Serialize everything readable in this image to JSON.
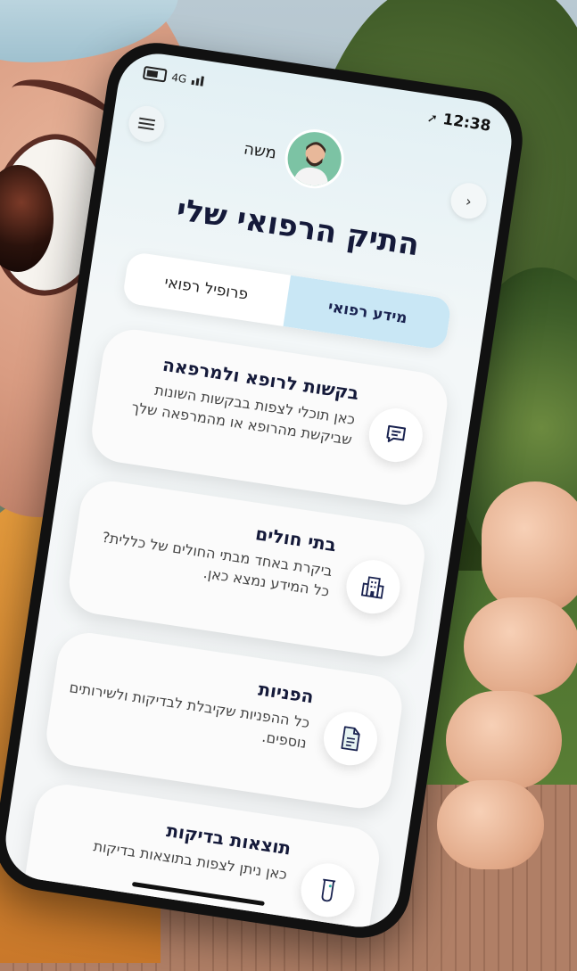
{
  "status_bar": {
    "network": "4G",
    "time": "12:38"
  },
  "header": {
    "user_name": "משה"
  },
  "page": {
    "title": "התיק הרפואי שלי"
  },
  "tabs": [
    {
      "label": "מידע רפואי",
      "active": true
    },
    {
      "label": "פרופיל רפואי",
      "active": false
    }
  ],
  "cards": [
    {
      "title": "בקשות לרופא ולמרפאה",
      "description": "כאן תוכלי לצפות בבקשות השונות שביקשת מהרופא או מהמרפאה שלך",
      "icon": "chat-icon"
    },
    {
      "title": "בתי חולים",
      "description": "ביקרת באחד מבתי החולים של כללית? כל המידע נמצא כאן.",
      "icon": "hospital-icon"
    },
    {
      "title": "הפניות",
      "description": "כל ההפניות שקיבלת לבדיקות ולשירותים נוספים.",
      "icon": "document-icon"
    },
    {
      "title": "תוצאות בדיקות",
      "description": "כאן ניתן לצפות בתוצאות בדיקות",
      "icon": "test-tube-icon"
    }
  ],
  "colors": {
    "title": "#151a3a",
    "active_tab": "#c9e7f5",
    "avatar_bg": "#7cc3a4"
  }
}
